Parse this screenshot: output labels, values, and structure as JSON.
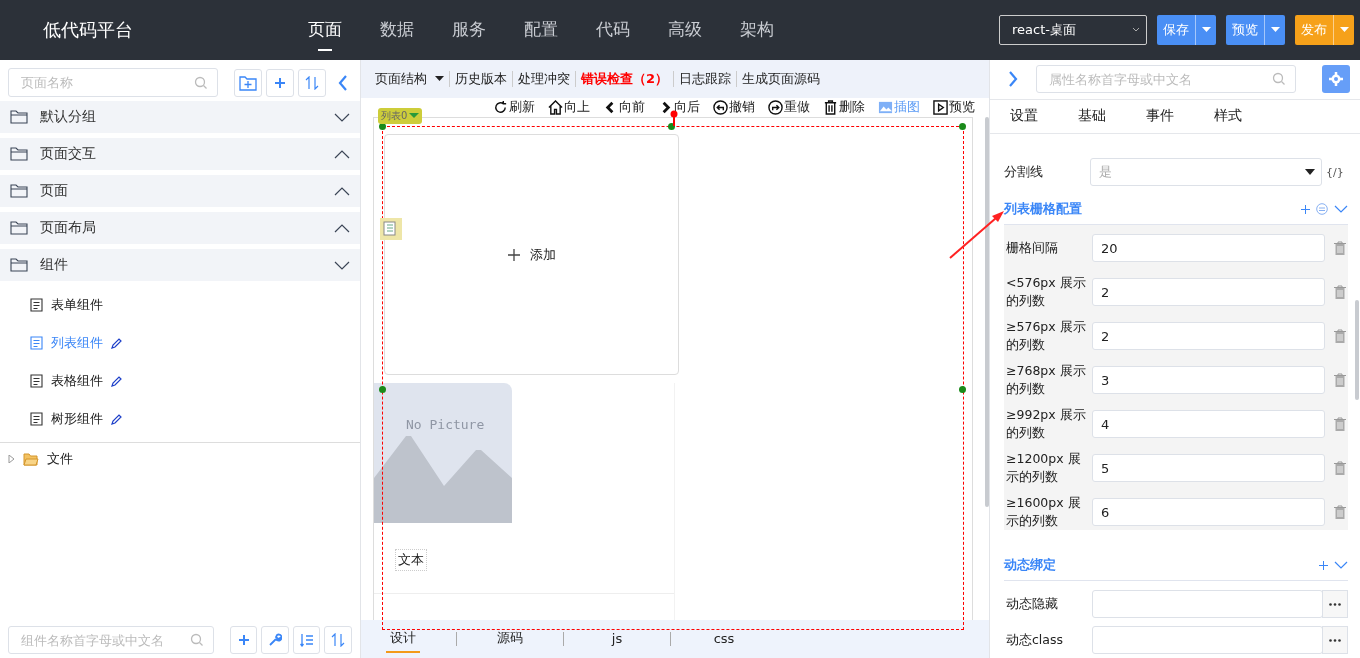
{
  "header": {
    "title": "低代码平台",
    "nav": [
      {
        "label": "页面",
        "selected": true
      },
      {
        "label": "数据",
        "selected": false
      },
      {
        "label": "服务",
        "selected": false
      },
      {
        "label": "配置",
        "selected": false
      },
      {
        "label": "代码",
        "selected": false
      },
      {
        "label": "高级",
        "selected": false
      },
      {
        "label": "架构",
        "selected": false
      }
    ],
    "target": "react-桌面",
    "buttons": [
      {
        "label": "保存",
        "color": "#4a8ff5"
      },
      {
        "label": "预览",
        "color": "#4a8ff5"
      },
      {
        "label": "发布",
        "color": "#f6a11a"
      }
    ]
  },
  "sidebar": {
    "search": {
      "placeholder": "页面名称"
    },
    "groups": [
      {
        "label": "默认分组",
        "expanded": true
      },
      {
        "label": "页面交互",
        "expanded": false
      },
      {
        "label": "页面",
        "expanded": false
      },
      {
        "label": "页面布局",
        "expanded": false
      },
      {
        "label": "组件",
        "expanded": true,
        "children": [
          {
            "label": "表单组件",
            "selected": false,
            "editable": false
          },
          {
            "label": "列表组件",
            "selected": true,
            "editable": true
          },
          {
            "label": "表格组件",
            "selected": false,
            "editable": true
          },
          {
            "label": "树形组件",
            "selected": false,
            "editable": true
          }
        ]
      }
    ],
    "files": [
      {
        "label": "文件",
        "expanded": false
      }
    ],
    "component_search": {
      "placeholder": "组件名称首字母或中文名"
    }
  },
  "editor": {
    "menu": [
      {
        "label": "页面结构",
        "dropdown": true,
        "alert": false
      },
      {
        "label": "历史版本",
        "dropdown": false,
        "alert": false
      },
      {
        "label": "处理冲突",
        "dropdown": false,
        "alert": false
      },
      {
        "label": "错误检查（2）",
        "dropdown": false,
        "alert": true
      },
      {
        "label": "日志跟踪",
        "dropdown": false,
        "alert": false
      },
      {
        "label": "生成页面源码",
        "dropdown": false,
        "alert": false
      }
    ],
    "actions": [
      {
        "label": "刷新",
        "selected": false
      },
      {
        "label": "向上",
        "selected": false
      },
      {
        "label": "向前",
        "selected": false
      },
      {
        "label": "向后",
        "selected": false
      },
      {
        "label": "撤销",
        "selected": false
      },
      {
        "label": "重做",
        "selected": false
      },
      {
        "label": "删除",
        "selected": false
      },
      {
        "label": "插图",
        "selected": true
      },
      {
        "label": "预览",
        "selected": false
      }
    ],
    "canvas": {
      "tag": "列表0",
      "add_label": "添加",
      "placeholder_text": "No Picture",
      "item_text": "文本"
    },
    "tabs": [
      {
        "label": "设计",
        "selected": true
      },
      {
        "label": "源码",
        "selected": false
      },
      {
        "label": "js",
        "selected": false
      },
      {
        "label": "css",
        "selected": false
      }
    ]
  },
  "properties": {
    "search": {
      "placeholder": "属性名称首字母或中文名"
    },
    "tabs": [
      "设置",
      "基础",
      "事件",
      "样式"
    ],
    "divider_field": {
      "label": "分割线",
      "value": "是",
      "expr": "{/}"
    },
    "sections": [
      {
        "title": "列表栅格配置",
        "kind": "grid",
        "rows": [
          {
            "label": "栅格间隔",
            "value": "20"
          },
          {
            "label": "<576px 展示的列数",
            "value": "2"
          },
          {
            "label": "≥576px 展示的列数",
            "value": "2"
          },
          {
            "label": "≥768px 展示的列数",
            "value": "3"
          },
          {
            "label": "≥992px 展示的列数",
            "value": "4"
          },
          {
            "label": "≥1200px 展示的列数",
            "value": "5"
          },
          {
            "label": "≥1600px 展示的列数",
            "value": "6"
          }
        ]
      },
      {
        "title": "动态绑定",
        "kind": "binding",
        "rows": [
          {
            "label": "动态隐藏"
          },
          {
            "label": "动态class"
          }
        ]
      }
    ]
  }
}
